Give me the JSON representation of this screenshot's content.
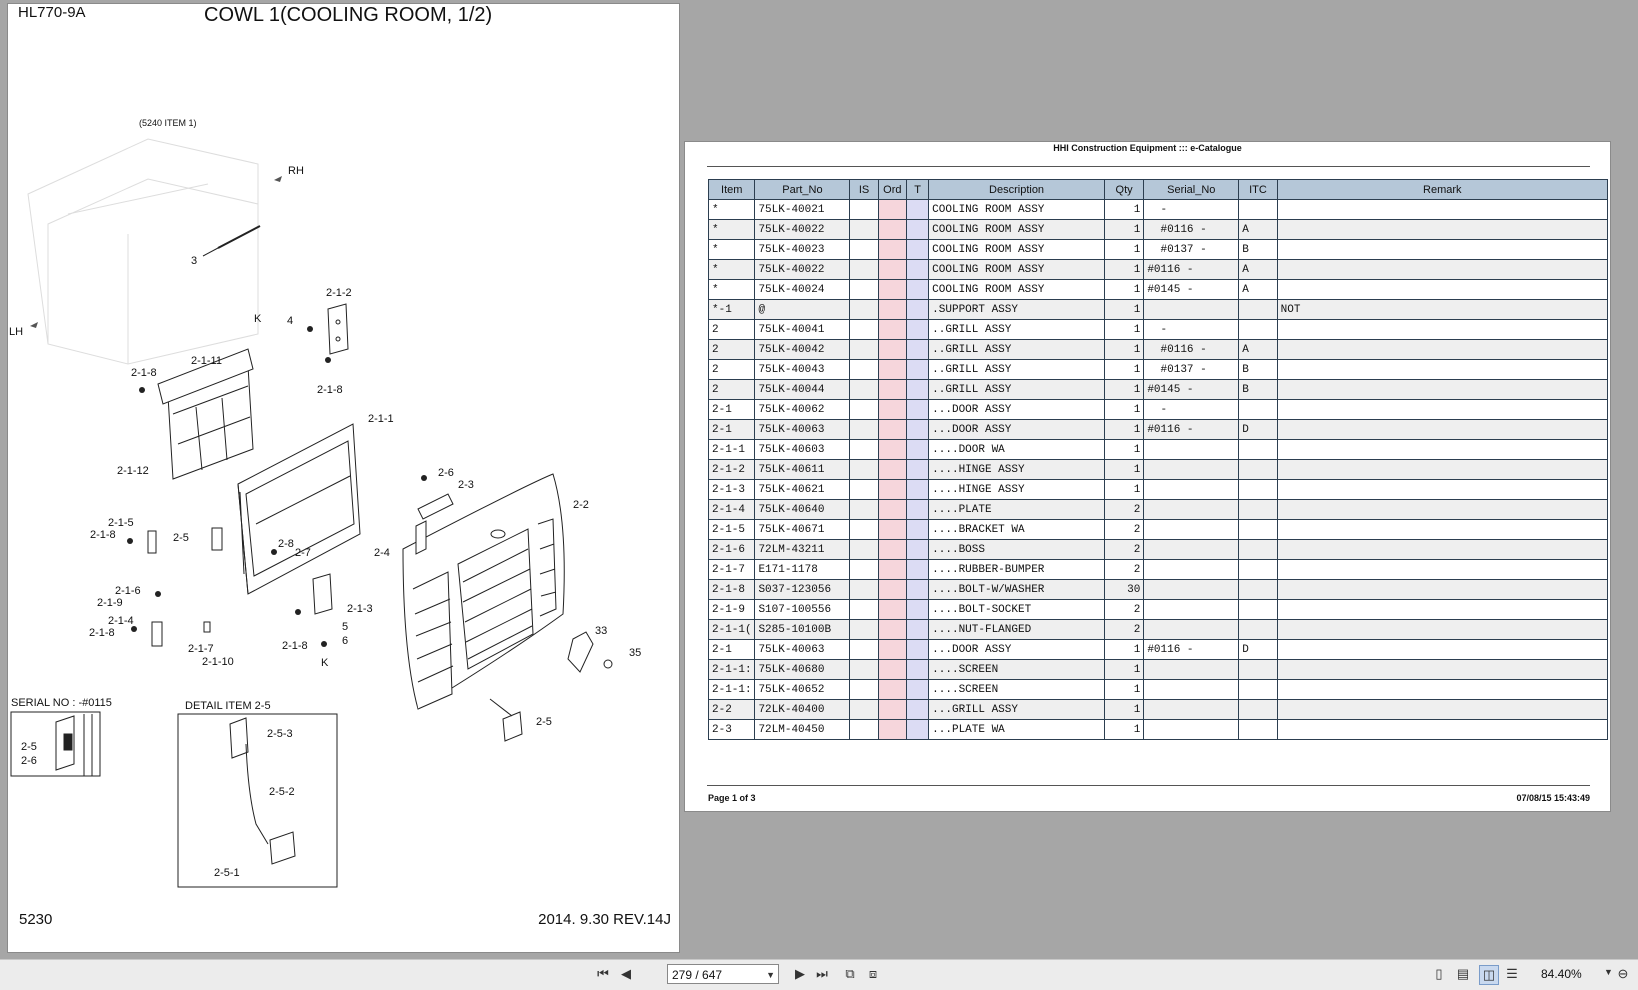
{
  "left_page": {
    "model": "HL770-9A",
    "title": "COWL 1(COOLING ROOM, 1/2)",
    "page_number": "5230",
    "revision": "2014. 9.30  REV.14J",
    "ref_note": "(5240 ITEM 1)",
    "rh": "RH",
    "lh": "LH",
    "serial_label": "SERIAL NO : -#0115",
    "detail_label": "DETAIL ITEM 2-5",
    "callouts": [
      "3",
      "K",
      "4",
      "2-1-2",
      "2-1-8",
      "2-1-11",
      "2-1-8",
      "2-1-1",
      "2-1-12",
      "2-1-5",
      "2-1-8",
      "2-5",
      "2-8",
      "2-7",
      "2-1-6",
      "2-1-9",
      "2-1-4",
      "2-1-8",
      "2-1-7",
      "2-1-10",
      "2-1-3",
      "5",
      "6",
      "2-1-8",
      "K",
      "2-6",
      "2-3",
      "2-2",
      "2-4",
      "33",
      "35",
      "2-5",
      "2-5",
      "2-6",
      "2-5-3",
      "2-5-2",
      "2-5-1"
    ]
  },
  "catalogue": {
    "header": "HHI Construction Equipment ::: e-Catalogue",
    "columns": [
      "Item",
      "Part_No",
      "IS",
      "Ord",
      "T",
      "Description",
      "Qty",
      "Serial_No",
      "ITC",
      "Remark"
    ],
    "rows": [
      [
        "*",
        "75LK-40021",
        "",
        "",
        "",
        "COOLING ROOM ASSY",
        "1",
        "  -",
        "",
        ""
      ],
      [
        "*",
        "75LK-40022",
        "",
        "",
        "",
        "COOLING ROOM ASSY",
        "1",
        "  #0116 -",
        "A",
        ""
      ],
      [
        "*",
        "75LK-40023",
        "",
        "",
        "",
        "COOLING ROOM ASSY",
        "1",
        "  #0137 -",
        "B",
        ""
      ],
      [
        "*",
        "75LK-40022",
        "",
        "",
        "",
        "COOLING ROOM ASSY",
        "1",
        "#0116 -",
        "A",
        ""
      ],
      [
        "*",
        "75LK-40024",
        "",
        "",
        "",
        "COOLING ROOM ASSY",
        "1",
        "#0145 -",
        "A",
        ""
      ],
      [
        "*-1",
        "@",
        "",
        "",
        "",
        ".SUPPORT ASSY",
        "1",
        "",
        "",
        "NOT"
      ],
      [
        "2",
        "75LK-40041",
        "",
        "",
        "",
        "..GRILL ASSY",
        "1",
        "  -",
        "",
        ""
      ],
      [
        "2",
        "75LK-40042",
        "",
        "",
        "",
        "..GRILL ASSY",
        "1",
        "  #0116 -",
        "A",
        ""
      ],
      [
        "2",
        "75LK-40043",
        "",
        "",
        "",
        "..GRILL ASSY",
        "1",
        "  #0137 -",
        "B",
        ""
      ],
      [
        "2",
        "75LK-40044",
        "",
        "",
        "",
        "..GRILL ASSY",
        "1",
        "#0145 -",
        "B",
        ""
      ],
      [
        "2-1",
        "75LK-40062",
        "",
        "",
        "",
        "...DOOR ASSY",
        "1",
        "  -",
        "",
        ""
      ],
      [
        "2-1",
        "75LK-40063",
        "",
        "",
        "",
        "...DOOR ASSY",
        "1",
        "#0116 -",
        "D",
        ""
      ],
      [
        "2-1-1",
        "75LK-40603",
        "",
        "",
        "",
        "....DOOR WA",
        "1",
        "",
        "",
        ""
      ],
      [
        "2-1-2",
        "75LK-40611",
        "",
        "",
        "",
        "....HINGE ASSY",
        "1",
        "",
        "",
        ""
      ],
      [
        "2-1-3",
        "75LK-40621",
        "",
        "",
        "",
        "....HINGE ASSY",
        "1",
        "",
        "",
        ""
      ],
      [
        "2-1-4",
        "75LK-40640",
        "",
        "",
        "",
        "....PLATE",
        "2",
        "",
        "",
        ""
      ],
      [
        "2-1-5",
        "75LK-40671",
        "",
        "",
        "",
        "....BRACKET WA",
        "2",
        "",
        "",
        ""
      ],
      [
        "2-1-6",
        "72LM-43211",
        "",
        "",
        "",
        "....BOSS",
        "2",
        "",
        "",
        ""
      ],
      [
        "2-1-7",
        "E171-1178",
        "",
        "",
        "",
        "....RUBBER-BUMPER",
        "2",
        "",
        "",
        ""
      ],
      [
        "2-1-8",
        "S037-123056",
        "",
        "",
        "",
        "....BOLT-W/WASHER",
        "30",
        "",
        "",
        ""
      ],
      [
        "2-1-9",
        "S107-100556",
        "",
        "",
        "",
        "....BOLT-SOCKET",
        "2",
        "",
        "",
        ""
      ],
      [
        "2-1-1(",
        "S285-10100B",
        "",
        "",
        "",
        "....NUT-FLANGED",
        "2",
        "",
        "",
        ""
      ],
      [
        "2-1",
        "75LK-40063",
        "",
        "",
        "",
        "...DOOR ASSY",
        "1",
        "#0116 -",
        "D",
        ""
      ],
      [
        "2-1-1:",
        "75LK-40680",
        "",
        "",
        "",
        "....SCREEN",
        "1",
        "",
        "",
        ""
      ],
      [
        "2-1-1:",
        "75LK-40652",
        "",
        "",
        "",
        "....SCREEN",
        "1",
        "",
        "",
        ""
      ],
      [
        "2-2",
        "72LK-40400",
        "",
        "",
        "",
        "...GRILL ASSY",
        "1",
        "",
        "",
        ""
      ],
      [
        "2-3",
        "72LM-40450",
        "",
        "",
        "",
        "...PLATE WA",
        "1",
        "",
        "",
        ""
      ]
    ],
    "footer_page": "Page 1 of 3",
    "footer_date": "07/08/15 15:43:49"
  },
  "toolbar": {
    "page_input": "279 / 647",
    "zoom": "84.40%",
    "icons": [
      "first-page-icon",
      "prev-page-icon",
      "next-page-icon",
      "last-page-icon",
      "fit-page-icon",
      "fit-width-icon",
      "single-page-icon",
      "continuous-icon",
      "facing-icon",
      "facing-continuous-icon",
      "zoom-out-icon"
    ]
  }
}
